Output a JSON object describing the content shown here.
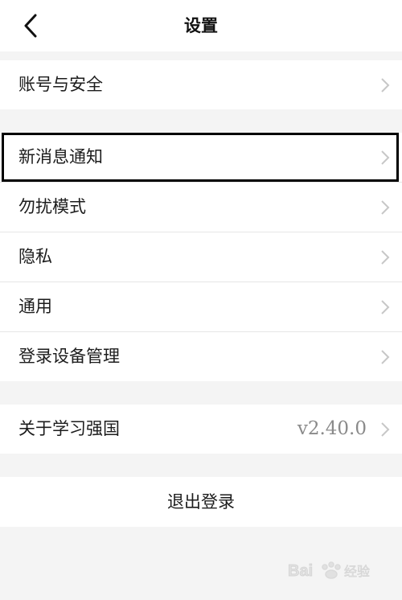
{
  "header": {
    "title": "设置",
    "back_icon": "chevron-left-icon"
  },
  "groups": {
    "account": {
      "label": "账号与安全"
    },
    "items": [
      {
        "label": "新消息通知"
      },
      {
        "label": "勿扰模式"
      },
      {
        "label": "隐私"
      },
      {
        "label": "通用"
      },
      {
        "label": "登录设备管理"
      }
    ],
    "about": {
      "label": "关于学习强国",
      "version": "v2.40.0"
    }
  },
  "logout": {
    "label": "退出登录"
  },
  "watermark": {
    "text": "Baidu 经验"
  },
  "colors": {
    "background": "#f4f4f4",
    "row": "#ffffff",
    "divider": "#e6e6e6",
    "chevron": "#c7c7c7",
    "value_text": "#8a8a8a",
    "highlight_border": "#000000"
  }
}
